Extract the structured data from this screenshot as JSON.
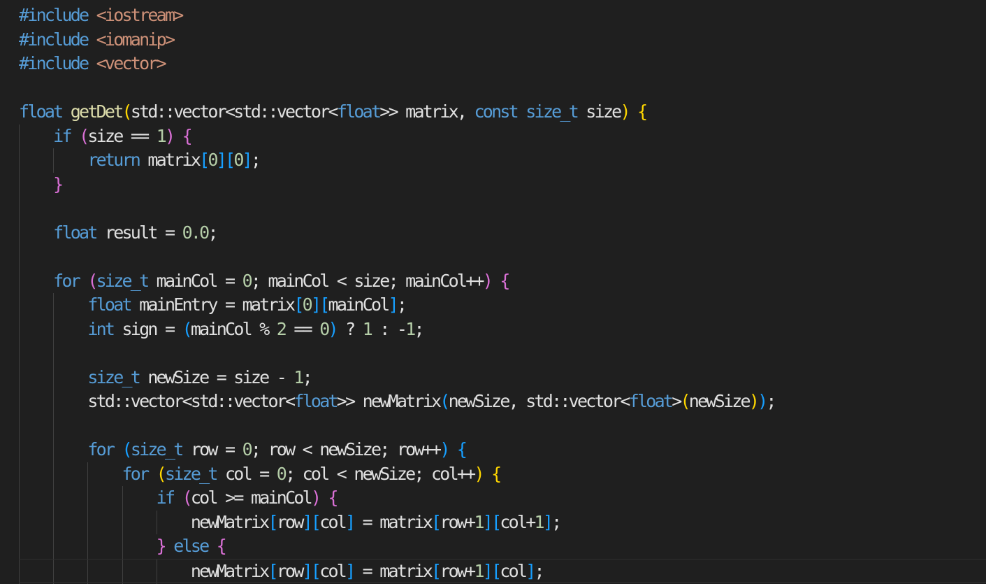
{
  "editor": {
    "language": "cpp",
    "colors": {
      "background": "#1f1f1f",
      "keyword": "#569cd6",
      "string": "#ce9178",
      "number": "#b5cea8",
      "function": "#dcdcaa",
      "bracket_1": "#ffd700",
      "bracket_2": "#da70d6",
      "bracket_3": "#179fff",
      "identifier": "#e0e0e0"
    },
    "lines": [
      [
        [
          "dir",
          "#include "
        ],
        [
          "str",
          "<iostream>"
        ]
      ],
      [
        [
          "dir",
          "#include "
        ],
        [
          "str",
          "<iomanip>"
        ]
      ],
      [
        [
          "dir",
          "#include "
        ],
        [
          "str",
          "<vector>"
        ]
      ],
      [],
      [
        [
          "type",
          "float"
        ],
        [
          "id",
          " "
        ],
        [
          "fn",
          "getDet"
        ],
        [
          "p1",
          "("
        ],
        [
          "id",
          "std::vector<std::vector<"
        ],
        [
          "type",
          "float"
        ],
        [
          "id",
          ">> matrix, "
        ],
        [
          "kw",
          "const"
        ],
        [
          "id",
          " "
        ],
        [
          "type",
          "size_t"
        ],
        [
          "id",
          " size"
        ],
        [
          "p1",
          ")"
        ],
        [
          "id",
          " "
        ],
        [
          "p1",
          "{"
        ]
      ],
      [
        [
          "id",
          "    "
        ],
        [
          "ctl",
          "if"
        ],
        [
          "id",
          " "
        ],
        [
          "p2",
          "("
        ],
        [
          "id",
          "size == "
        ],
        [
          "num",
          "1"
        ],
        [
          "p2",
          ")"
        ],
        [
          "id",
          " "
        ],
        [
          "p2",
          "{"
        ]
      ],
      [
        [
          "id",
          "        "
        ],
        [
          "ctl",
          "return"
        ],
        [
          "id",
          " matrix"
        ],
        [
          "p3",
          "["
        ],
        [
          "num",
          "0"
        ],
        [
          "p3",
          "]["
        ],
        [
          "num",
          "0"
        ],
        [
          "p3",
          "]"
        ],
        [
          "id",
          ";"
        ]
      ],
      [
        [
          "id",
          "    "
        ],
        [
          "p2",
          "}"
        ]
      ],
      [],
      [
        [
          "id",
          "    "
        ],
        [
          "type",
          "float"
        ],
        [
          "id",
          " result = "
        ],
        [
          "num",
          "0.0"
        ],
        [
          "id",
          ";"
        ]
      ],
      [],
      [
        [
          "id",
          "    "
        ],
        [
          "ctl",
          "for"
        ],
        [
          "id",
          " "
        ],
        [
          "p2",
          "("
        ],
        [
          "type",
          "size_t"
        ],
        [
          "id",
          " mainCol = "
        ],
        [
          "num",
          "0"
        ],
        [
          "id",
          "; mainCol < size; mainCol++"
        ],
        [
          "p2",
          ")"
        ],
        [
          "id",
          " "
        ],
        [
          "p2",
          "{"
        ]
      ],
      [
        [
          "id",
          "        "
        ],
        [
          "type",
          "float"
        ],
        [
          "id",
          " mainEntry = matrix"
        ],
        [
          "p3",
          "["
        ],
        [
          "num",
          "0"
        ],
        [
          "p3",
          "]["
        ],
        [
          "id",
          "mainCol"
        ],
        [
          "p3",
          "]"
        ],
        [
          "id",
          ";"
        ]
      ],
      [
        [
          "id",
          "        "
        ],
        [
          "type",
          "int"
        ],
        [
          "id",
          " sign = "
        ],
        [
          "p3",
          "("
        ],
        [
          "id",
          "mainCol % "
        ],
        [
          "num",
          "2"
        ],
        [
          "id",
          " == "
        ],
        [
          "num",
          "0"
        ],
        [
          "p3",
          ")"
        ],
        [
          "id",
          " ? "
        ],
        [
          "num",
          "1"
        ],
        [
          "id",
          " : -"
        ],
        [
          "num",
          "1"
        ],
        [
          "id",
          ";"
        ]
      ],
      [],
      [
        [
          "id",
          "        "
        ],
        [
          "type",
          "size_t"
        ],
        [
          "id",
          " newSize = size - "
        ],
        [
          "num",
          "1"
        ],
        [
          "id",
          ";"
        ]
      ],
      [
        [
          "id",
          "        std::vector<std::vector<"
        ],
        [
          "type",
          "float"
        ],
        [
          "id",
          ">> newMatrix"
        ],
        [
          "p3",
          "("
        ],
        [
          "id",
          "newSize, std::vector<"
        ],
        [
          "type",
          "float"
        ],
        [
          "id",
          ">"
        ],
        [
          "p1",
          "("
        ],
        [
          "id",
          "newSize"
        ],
        [
          "p1",
          ")"
        ],
        [
          "p3",
          ")"
        ],
        [
          "id",
          ";"
        ]
      ],
      [],
      [
        [
          "id",
          "        "
        ],
        [
          "ctl",
          "for"
        ],
        [
          "id",
          " "
        ],
        [
          "p3",
          "("
        ],
        [
          "type",
          "size_t"
        ],
        [
          "id",
          " row = "
        ],
        [
          "num",
          "0"
        ],
        [
          "id",
          "; row < newSize; row++"
        ],
        [
          "p3",
          ")"
        ],
        [
          "id",
          " "
        ],
        [
          "p3",
          "{"
        ]
      ],
      [
        [
          "id",
          "            "
        ],
        [
          "ctl",
          "for"
        ],
        [
          "id",
          " "
        ],
        [
          "p1",
          "("
        ],
        [
          "type",
          "size_t"
        ],
        [
          "id",
          " col = "
        ],
        [
          "num",
          "0"
        ],
        [
          "id",
          "; col < newSize; col++"
        ],
        [
          "p1",
          ")"
        ],
        [
          "id",
          " "
        ],
        [
          "p1",
          "{"
        ]
      ],
      [
        [
          "id",
          "                "
        ],
        [
          "ctl",
          "if"
        ],
        [
          "id",
          " "
        ],
        [
          "p2",
          "("
        ],
        [
          "id",
          "col >= mainCol"
        ],
        [
          "p2",
          ")"
        ],
        [
          "id",
          " "
        ],
        [
          "p2",
          "{"
        ]
      ],
      [
        [
          "id",
          "                    newMatrix"
        ],
        [
          "p3",
          "["
        ],
        [
          "id",
          "row"
        ],
        [
          "p3",
          "]["
        ],
        [
          "id",
          "col"
        ],
        [
          "p3",
          "]"
        ],
        [
          "id",
          " = matrix"
        ],
        [
          "p3",
          "["
        ],
        [
          "id",
          "row+"
        ],
        [
          "num",
          "1"
        ],
        [
          "p3",
          "]["
        ],
        [
          "id",
          "col+"
        ],
        [
          "num",
          "1"
        ],
        [
          "p3",
          "]"
        ],
        [
          "id",
          ";"
        ]
      ],
      [
        [
          "id",
          "                "
        ],
        [
          "p2",
          "}"
        ],
        [
          "id",
          " "
        ],
        [
          "ctl",
          "else"
        ],
        [
          "id",
          " "
        ],
        [
          "p2",
          "{"
        ]
      ],
      [
        [
          "id",
          "                    newMatrix"
        ],
        [
          "p3",
          "["
        ],
        [
          "id",
          "row"
        ],
        [
          "p3",
          "]["
        ],
        [
          "id",
          "col"
        ],
        [
          "p3",
          "]"
        ],
        [
          "id",
          " = matrix"
        ],
        [
          "p3",
          "["
        ],
        [
          "id",
          "row+"
        ],
        [
          "num",
          "1"
        ],
        [
          "p3",
          "]["
        ],
        [
          "id",
          "col"
        ],
        [
          "p3",
          "]"
        ],
        [
          "id",
          ";"
        ]
      ]
    ],
    "current_line": 23
  }
}
